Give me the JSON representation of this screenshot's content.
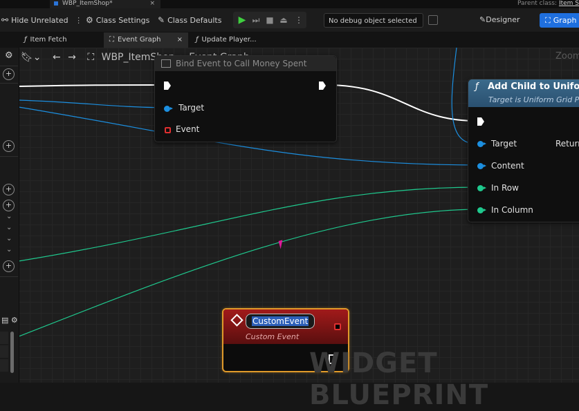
{
  "window": {
    "doc_tab": "WBP_ItemShop*",
    "parent_class_label": "Parent class:",
    "parent_class_value": "Item S"
  },
  "toolbar": {
    "hide_unrelated": "Hide Unrelated",
    "class_settings": "Class Settings",
    "class_defaults": "Class Defaults",
    "debug_object": "No debug object selected",
    "designer": "Designer",
    "graph": "Graph"
  },
  "tabs": [
    "Item Fetch",
    "Event Graph",
    "Update Player..."
  ],
  "breadcrumb": {
    "blueprint": "WBP_ItemShop",
    "separator": "›",
    "graph": "Event Graph"
  },
  "zoom_label": "Zoom",
  "nodes": {
    "bind_event": {
      "title": "Bind Event to Call Money Spent",
      "pins": [
        "Target",
        "Event"
      ]
    },
    "add_child": {
      "title": "Add Child to Uniform",
      "subtitle": "Target is Uniform Grid P",
      "pins": [
        "Target",
        "Content",
        "In Row",
        "In Column"
      ],
      "output": "Return"
    },
    "custom_event": {
      "name": "CustomEvent",
      "subtitle": "Custom Event"
    }
  },
  "watermark": "WIDGET BLUEPRINT",
  "colors": {
    "exec_wire": "#ffffff",
    "object_pin": "#1c8fe0",
    "int_pin": "#1fc98e",
    "graph_button": "#1f6fde",
    "custom_event_header": "#a11a1a",
    "selected_outline": "#e09a2a"
  }
}
